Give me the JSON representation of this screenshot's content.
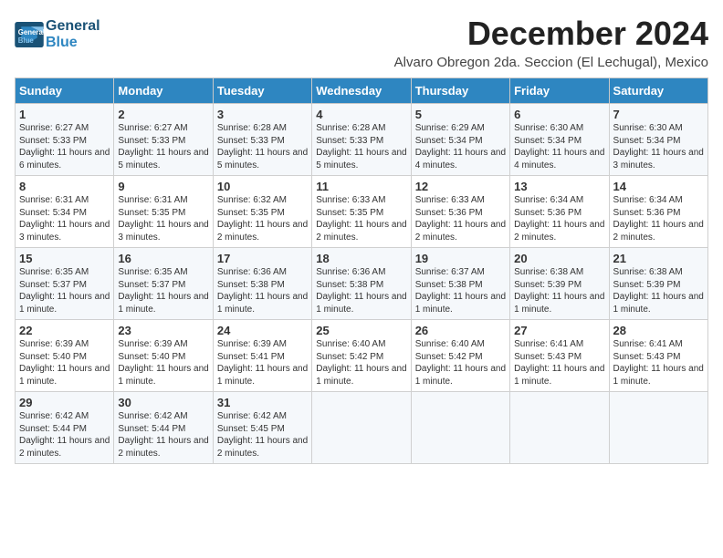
{
  "header": {
    "logo_line1": "General",
    "logo_line2": "Blue",
    "main_title": "December 2024",
    "subtitle": "Alvaro Obregon 2da. Seccion (El Lechugal), Mexico"
  },
  "days_of_week": [
    "Sunday",
    "Monday",
    "Tuesday",
    "Wednesday",
    "Thursday",
    "Friday",
    "Saturday"
  ],
  "weeks": [
    [
      {
        "day": "1",
        "sunrise": "6:27 AM",
        "sunset": "5:33 PM",
        "daylight": "11 hours and 6 minutes."
      },
      {
        "day": "2",
        "sunrise": "6:27 AM",
        "sunset": "5:33 PM",
        "daylight": "11 hours and 5 minutes."
      },
      {
        "day": "3",
        "sunrise": "6:28 AM",
        "sunset": "5:33 PM",
        "daylight": "11 hours and 5 minutes."
      },
      {
        "day": "4",
        "sunrise": "6:28 AM",
        "sunset": "5:33 PM",
        "daylight": "11 hours and 5 minutes."
      },
      {
        "day": "5",
        "sunrise": "6:29 AM",
        "sunset": "5:34 PM",
        "daylight": "11 hours and 4 minutes."
      },
      {
        "day": "6",
        "sunrise": "6:30 AM",
        "sunset": "5:34 PM",
        "daylight": "11 hours and 4 minutes."
      },
      {
        "day": "7",
        "sunrise": "6:30 AM",
        "sunset": "5:34 PM",
        "daylight": "11 hours and 3 minutes."
      }
    ],
    [
      {
        "day": "8",
        "sunrise": "6:31 AM",
        "sunset": "5:34 PM",
        "daylight": "11 hours and 3 minutes."
      },
      {
        "day": "9",
        "sunrise": "6:31 AM",
        "sunset": "5:35 PM",
        "daylight": "11 hours and 3 minutes."
      },
      {
        "day": "10",
        "sunrise": "6:32 AM",
        "sunset": "5:35 PM",
        "daylight": "11 hours and 2 minutes."
      },
      {
        "day": "11",
        "sunrise": "6:33 AM",
        "sunset": "5:35 PM",
        "daylight": "11 hours and 2 minutes."
      },
      {
        "day": "12",
        "sunrise": "6:33 AM",
        "sunset": "5:36 PM",
        "daylight": "11 hours and 2 minutes."
      },
      {
        "day": "13",
        "sunrise": "6:34 AM",
        "sunset": "5:36 PM",
        "daylight": "11 hours and 2 minutes."
      },
      {
        "day": "14",
        "sunrise": "6:34 AM",
        "sunset": "5:36 PM",
        "daylight": "11 hours and 2 minutes."
      }
    ],
    [
      {
        "day": "15",
        "sunrise": "6:35 AM",
        "sunset": "5:37 PM",
        "daylight": "11 hours and 1 minute."
      },
      {
        "day": "16",
        "sunrise": "6:35 AM",
        "sunset": "5:37 PM",
        "daylight": "11 hours and 1 minute."
      },
      {
        "day": "17",
        "sunrise": "6:36 AM",
        "sunset": "5:38 PM",
        "daylight": "11 hours and 1 minute."
      },
      {
        "day": "18",
        "sunrise": "6:36 AM",
        "sunset": "5:38 PM",
        "daylight": "11 hours and 1 minute."
      },
      {
        "day": "19",
        "sunrise": "6:37 AM",
        "sunset": "5:38 PM",
        "daylight": "11 hours and 1 minute."
      },
      {
        "day": "20",
        "sunrise": "6:38 AM",
        "sunset": "5:39 PM",
        "daylight": "11 hours and 1 minute."
      },
      {
        "day": "21",
        "sunrise": "6:38 AM",
        "sunset": "5:39 PM",
        "daylight": "11 hours and 1 minute."
      }
    ],
    [
      {
        "day": "22",
        "sunrise": "6:39 AM",
        "sunset": "5:40 PM",
        "daylight": "11 hours and 1 minute."
      },
      {
        "day": "23",
        "sunrise": "6:39 AM",
        "sunset": "5:40 PM",
        "daylight": "11 hours and 1 minute."
      },
      {
        "day": "24",
        "sunrise": "6:39 AM",
        "sunset": "5:41 PM",
        "daylight": "11 hours and 1 minute."
      },
      {
        "day": "25",
        "sunrise": "6:40 AM",
        "sunset": "5:42 PM",
        "daylight": "11 hours and 1 minute."
      },
      {
        "day": "26",
        "sunrise": "6:40 AM",
        "sunset": "5:42 PM",
        "daylight": "11 hours and 1 minute."
      },
      {
        "day": "27",
        "sunrise": "6:41 AM",
        "sunset": "5:43 PM",
        "daylight": "11 hours and 1 minute."
      },
      {
        "day": "28",
        "sunrise": "6:41 AM",
        "sunset": "5:43 PM",
        "daylight": "11 hours and 1 minute."
      }
    ],
    [
      {
        "day": "29",
        "sunrise": "6:42 AM",
        "sunset": "5:44 PM",
        "daylight": "11 hours and 2 minutes."
      },
      {
        "day": "30",
        "sunrise": "6:42 AM",
        "sunset": "5:44 PM",
        "daylight": "11 hours and 2 minutes."
      },
      {
        "day": "31",
        "sunrise": "6:42 AM",
        "sunset": "5:45 PM",
        "daylight": "11 hours and 2 minutes."
      },
      null,
      null,
      null,
      null
    ]
  ]
}
